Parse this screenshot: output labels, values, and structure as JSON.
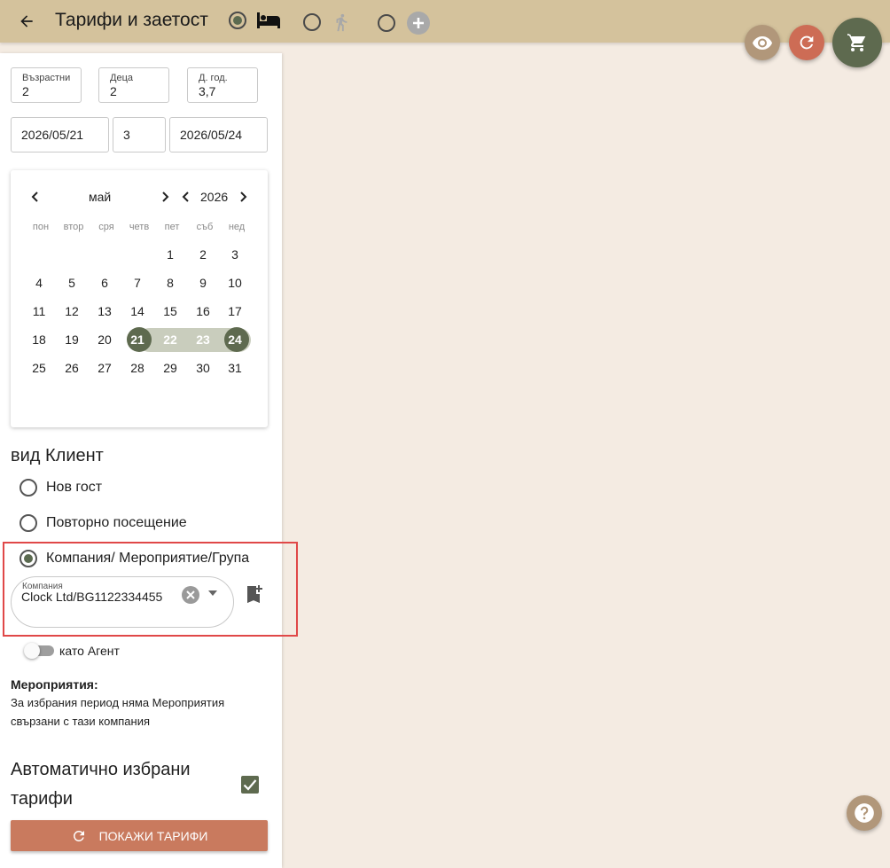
{
  "header": {
    "title": "Тарифи и заетост",
    "modes": [
      {
        "name": "bed",
        "selected": true
      },
      {
        "name": "person-walking",
        "selected": false
      },
      {
        "name": "plus",
        "selected": false
      }
    ]
  },
  "fabs": {
    "view": "eye-icon",
    "refresh": "refresh-icon",
    "cart": "cart-icon"
  },
  "guests": {
    "adults_label": "Възрастни",
    "adults": "2",
    "children_label": "Деца",
    "children": "2",
    "ages_label": "Д. год.",
    "ages": "3,7"
  },
  "dates": {
    "from": "2026/05/21",
    "nights": "3",
    "to": "2026/05/24"
  },
  "calendar": {
    "month": "май",
    "year": "2026",
    "weekdays": [
      "пон",
      "втор",
      "сря",
      "четв",
      "пет",
      "съб",
      "нед"
    ],
    "weeks": [
      [
        "",
        "",
        "",
        "",
        "1",
        "2",
        "3"
      ],
      [
        "4",
        "5",
        "6",
        "7",
        "8",
        "9",
        "10"
      ],
      [
        "11",
        "12",
        "13",
        "14",
        "15",
        "16",
        "17"
      ],
      [
        "18",
        "19",
        "20",
        "21",
        "22",
        "23",
        "24"
      ],
      [
        "25",
        "26",
        "27",
        "28",
        "29",
        "30",
        "31"
      ]
    ],
    "range_start": "21",
    "range_end": "24"
  },
  "client": {
    "title": "вид Клиент",
    "options": [
      "Нов гост",
      "Повторно посещение",
      "Компания/ Мероприятие/Група"
    ],
    "selected_index": 2,
    "company_label": "Компания",
    "company_value": "Clock Ltd/BG1122334455",
    "agent_label": "като Агент"
  },
  "events": {
    "title": "Мероприятия:",
    "text_line1": "За избрания период няма Мероприятия",
    "text_line2": "свързани с тази компания"
  },
  "auto": {
    "label_line1": "Автоматично избрани",
    "label_line2": "тарифи",
    "checked": true
  },
  "actions": {
    "show_rates": "ПОКАЖИ ТАРИФИ"
  },
  "colors": {
    "accent": "#5e6a4f",
    "header": "#d4c29c",
    "button": "#c97a5e",
    "highlight": "#e04848"
  }
}
